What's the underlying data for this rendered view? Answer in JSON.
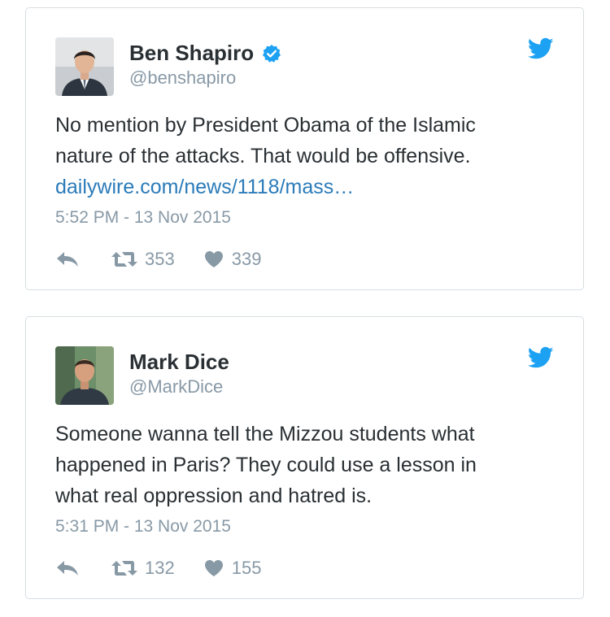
{
  "tweets": [
    {
      "name": "Ben Shapiro",
      "handle": "@benshapiro",
      "verified": true,
      "text_lines": [
        "No mention by President Obama of the Islamic",
        "nature of the attacks. That would be offensive."
      ],
      "link": "dailywire.com/news/1118/mass…",
      "timestamp": "5:52 PM - 13 Nov 2015",
      "retweets": "353",
      "likes": "339"
    },
    {
      "name": "Mark Dice",
      "handle": "@MarkDice",
      "verified": false,
      "text_lines": [
        "Someone wanna tell the Mizzou students what",
        "happened in Paris?  They could use a lesson in",
        "what real oppression and hatred is."
      ],
      "link": "",
      "timestamp": "5:31 PM - 13 Nov 2015",
      "retweets": "132",
      "likes": "155"
    }
  ],
  "icons": {
    "brand": "twitter-bird-icon",
    "verified": "verified-badge-icon",
    "reply": "reply-icon",
    "retweet": "retweet-icon",
    "like": "heart-icon"
  },
  "colors": {
    "twitter_blue": "#1da1f2",
    "link": "#2b7bb9",
    "muted": "#8899a6",
    "text": "#292f33",
    "border": "#d8dee2"
  }
}
